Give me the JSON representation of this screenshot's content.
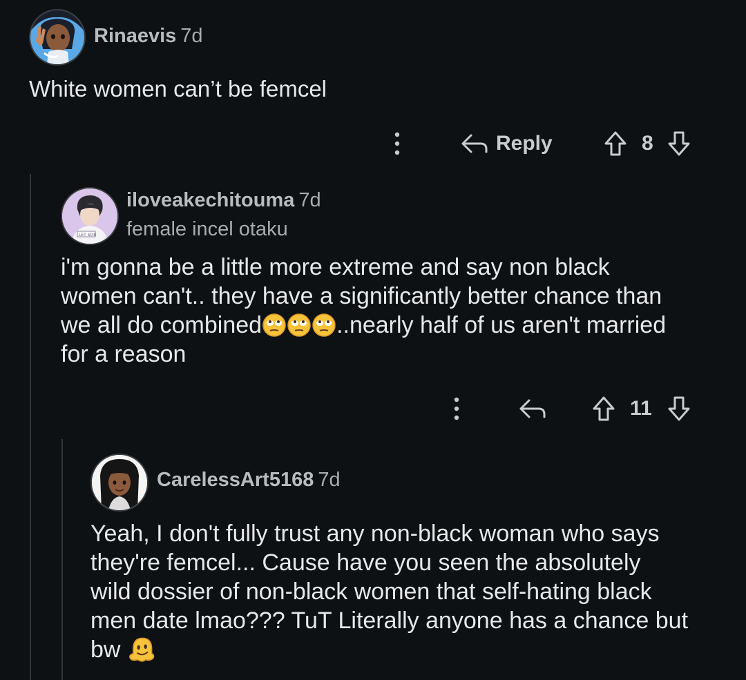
{
  "comments": [
    {
      "username": "Rinaevis",
      "time": "7d",
      "body": "White women can’t be femcel",
      "reply_label": "Reply",
      "score": "8",
      "avatar_icon": "avatar-anime-girl-peace-sign-icon"
    },
    {
      "username": "iloveakechitouma",
      "time": "7d",
      "flair": "female incel otaku",
      "body_lines": [
        "i'm gonna be a little more extreme and say non black",
        "women can't.. they have a significantly better chance than",
        "we all do combined",
        "..nearly half of us aren't married",
        "for a reason"
      ],
      "emoji": "face-with-rolling-eyes-icon",
      "score": "11",
      "avatar_icon": "avatar-anime-boy-icon"
    },
    {
      "username": "CarelessArt5168",
      "time": "7d",
      "body_lines": [
        "Yeah, I don't fully trust any non-black woman who says",
        "they're femcel... Cause have you seen the absolutely",
        "wild dossier of non-black women that self-hating black",
        "men date lmao??? TuT Literally anyone has a chance but",
        "bw "
      ],
      "emoji": "melting-face-icon",
      "avatar_icon": "avatar-anime-girl-icon"
    }
  ],
  "colors": {
    "background": "#0e1113",
    "thread_line": "#343536",
    "text": "#e6e8ea",
    "muted": "#a8acaf"
  }
}
